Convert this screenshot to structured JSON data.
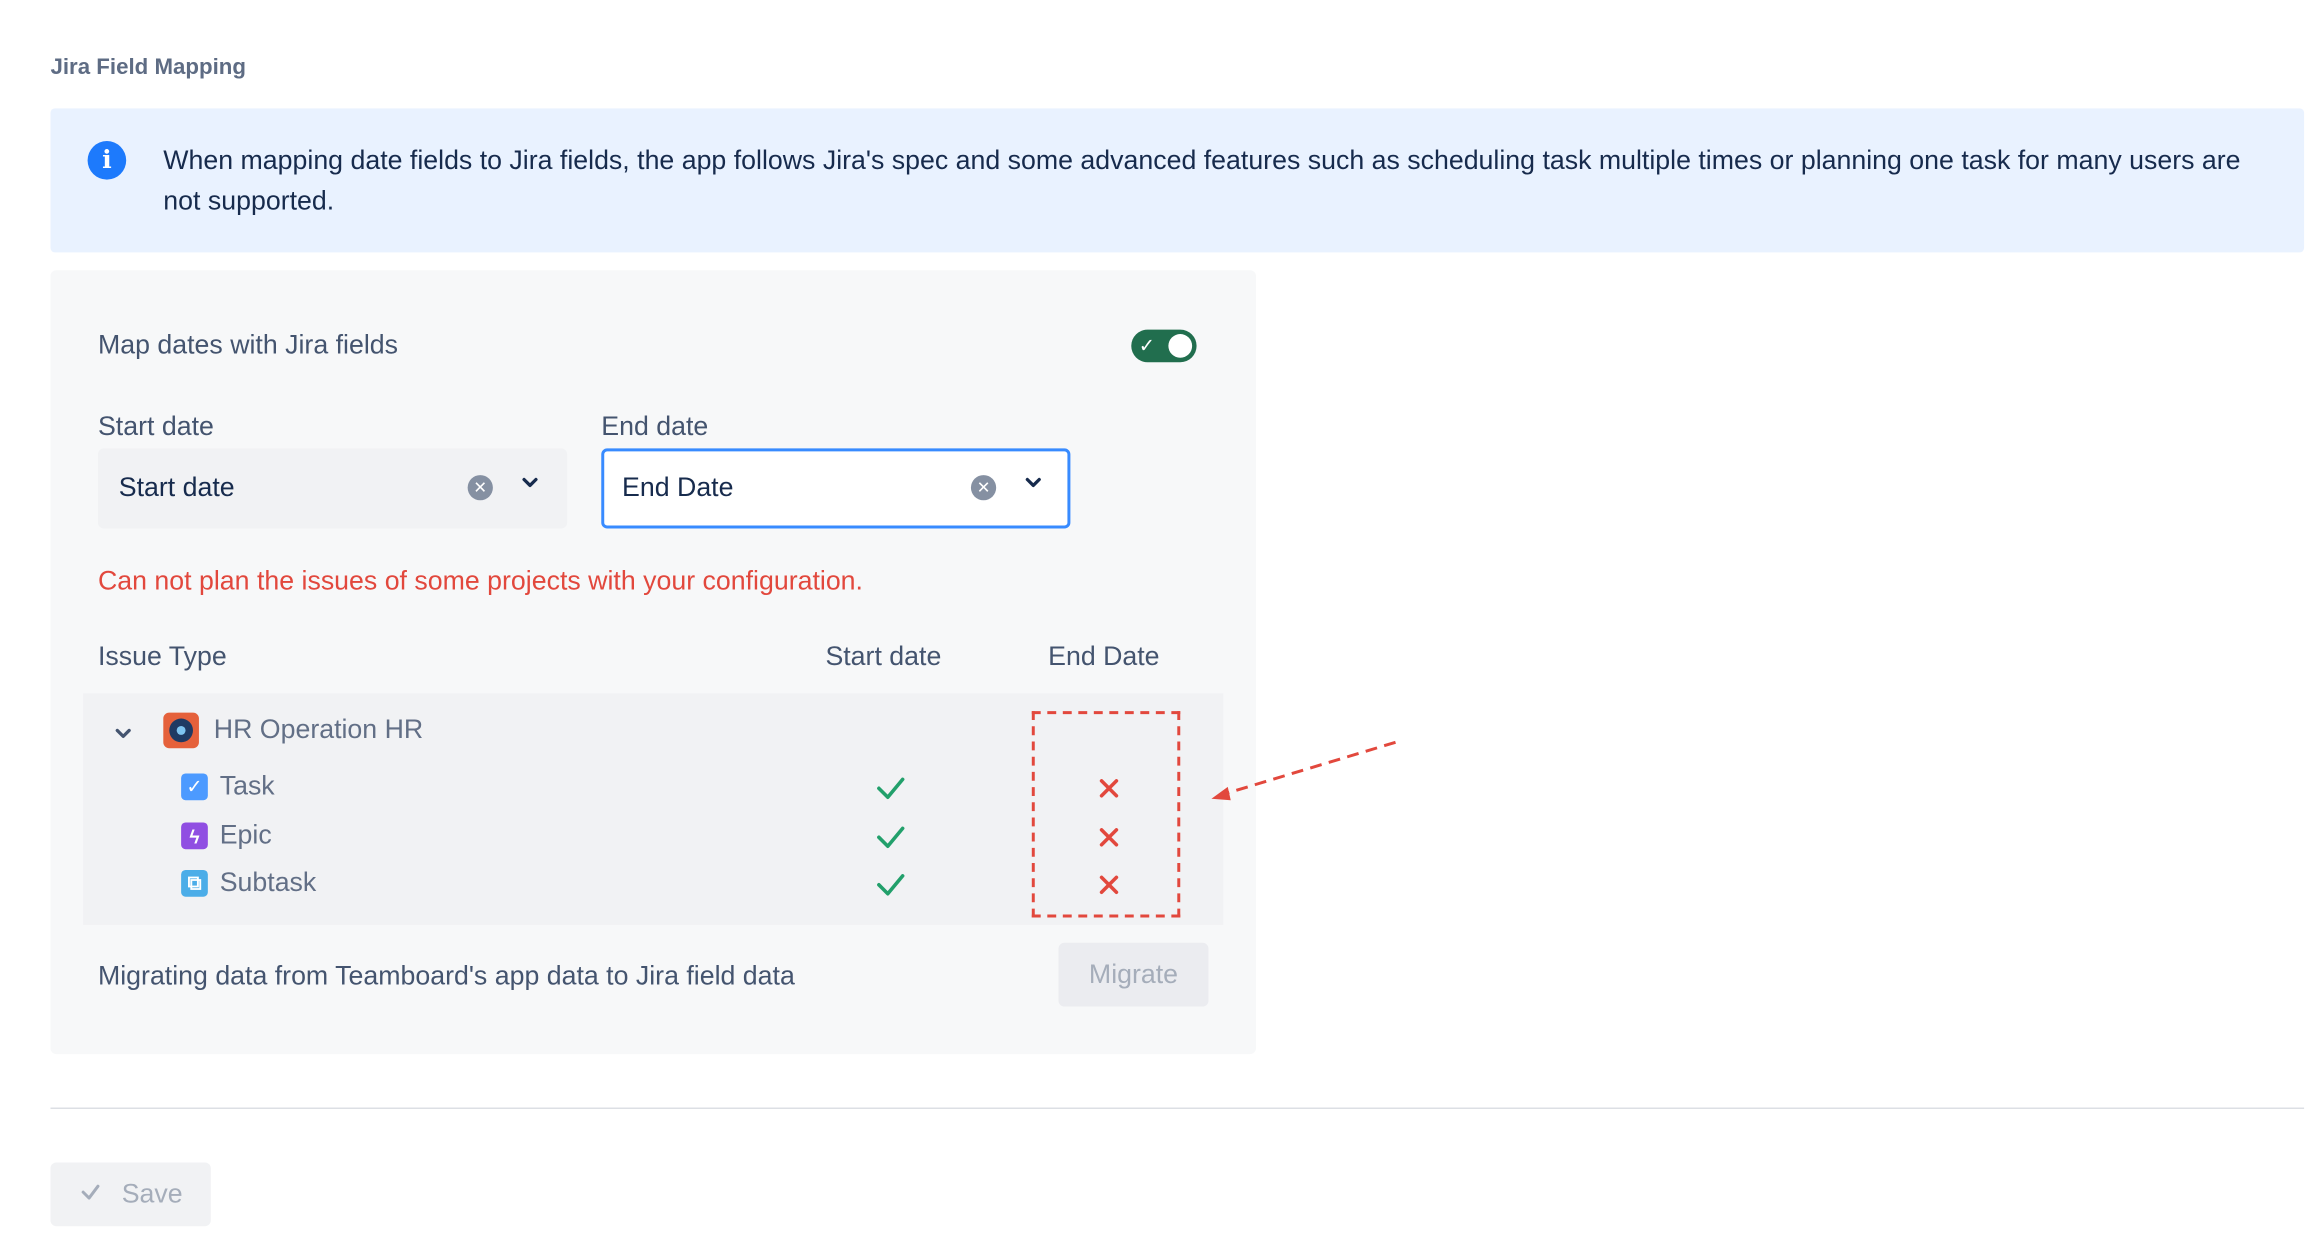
{
  "section": {
    "title": "Jira Field Mapping"
  },
  "info_banner": {
    "icon": "info-icon",
    "text": "When mapping date fields to Jira fields, the app follows Jira's spec and some advanced features such as scheduling task multiple times or planning one task for many users are not supported."
  },
  "mapping": {
    "toggle_label": "Map dates with Jira fields",
    "toggle_on": true,
    "start": {
      "label": "Start date",
      "value": "Start date"
    },
    "end": {
      "label": "End date",
      "value": "End Date"
    },
    "error": "Can not plan the issues of some projects with your configuration."
  },
  "table": {
    "headers": {
      "issue_type": "Issue Type",
      "start": "Start date",
      "end": "End Date"
    },
    "project": {
      "name": "HR Operation  HR",
      "expanded": true
    },
    "rows": [
      {
        "name": "Task",
        "icon": "task-icon",
        "icon_color": "#4c9aff",
        "start_ok": true,
        "end_ok": false
      },
      {
        "name": "Epic",
        "icon": "epic-icon",
        "icon_color": "#904ee2",
        "start_ok": true,
        "end_ok": false
      },
      {
        "name": "Subtask",
        "icon": "subtask-icon",
        "icon_color": "#4bade8",
        "start_ok": true,
        "end_ok": false
      }
    ]
  },
  "migrate": {
    "text": "Migrating data from Teamboard's app data to Jira field data",
    "button": "Migrate"
  },
  "footer": {
    "save": "Save"
  },
  "colors": {
    "accent": "#388bff",
    "error": "#e2483d",
    "success": "#22a06b",
    "toggle": "#216e4e",
    "banner_bg": "#e9f2ff"
  }
}
